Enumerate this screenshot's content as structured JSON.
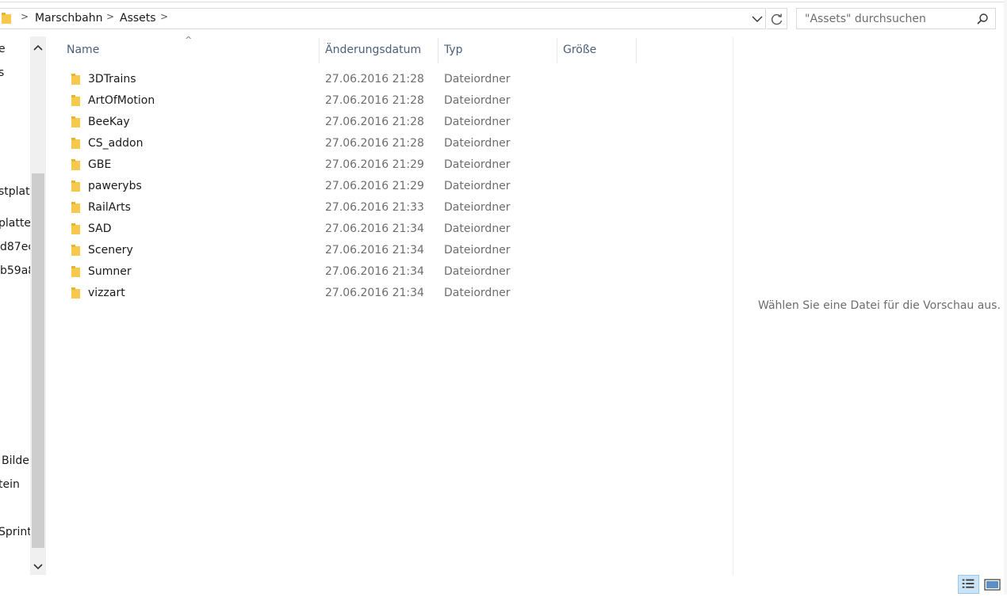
{
  "address_bar": {
    "breadcrumbs": [
      "Marschbahn",
      "Assets"
    ],
    "separator": ">"
  },
  "search": {
    "placeholder": "\"Assets\" durchsuchen"
  },
  "nav_pane": {
    "items": [
      "e",
      "s",
      "stplatt",
      "platte",
      "d87ec",
      "b59a8",
      "Bilde",
      "tein",
      "Sprint"
    ]
  },
  "columns": {
    "name": "Name",
    "date": "Änderungsdatum",
    "type": "Typ",
    "size": "Größe"
  },
  "files": [
    {
      "name": "3DTrains",
      "date": "27.06.2016 21:28",
      "type": "Dateiordner"
    },
    {
      "name": "ArtOfMotion",
      "date": "27.06.2016 21:28",
      "type": "Dateiordner"
    },
    {
      "name": "BeeKay",
      "date": "27.06.2016 21:28",
      "type": "Dateiordner"
    },
    {
      "name": "CS_addon",
      "date": "27.06.2016 21:28",
      "type": "Dateiordner"
    },
    {
      "name": "GBE",
      "date": "27.06.2016 21:29",
      "type": "Dateiordner"
    },
    {
      "name": "pawerybs",
      "date": "27.06.2016 21:29",
      "type": "Dateiordner"
    },
    {
      "name": "RailArts",
      "date": "27.06.2016 21:33",
      "type": "Dateiordner"
    },
    {
      "name": "SAD",
      "date": "27.06.2016 21:34",
      "type": "Dateiordner"
    },
    {
      "name": "Scenery",
      "date": "27.06.2016 21:34",
      "type": "Dateiordner"
    },
    {
      "name": "Sumner",
      "date": "27.06.2016 21:34",
      "type": "Dateiordner"
    },
    {
      "name": "vizzart",
      "date": "27.06.2016 21:34",
      "type": "Dateiordner"
    }
  ],
  "preview": {
    "message": "Wählen Sie eine Datei für die Vorschau aus."
  },
  "colors": {
    "folder": "#f6c94d",
    "header_text": "#4c607a",
    "muted_text": "#6d6d6d",
    "selected_view": "#cce4f7"
  },
  "icons": {
    "folder": "folder-icon",
    "dropdown": "chevron-down-icon",
    "refresh": "refresh-icon",
    "search": "search-icon",
    "details_view": "details-view-icon",
    "large_icons_view": "large-icons-view-icon"
  }
}
